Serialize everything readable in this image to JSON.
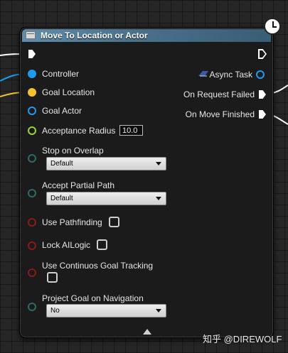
{
  "node": {
    "title": "Move To Location or Actor",
    "inputs": [
      {
        "label": "Controller",
        "color": "#1e9bf0",
        "filled": true
      },
      {
        "label": "Goal Location",
        "color": "#f6c22a",
        "filled": true
      },
      {
        "label": "Goal Actor",
        "color": "#1e9bf0",
        "filled": false
      },
      {
        "label": "Acceptance Radius",
        "color": "#9bd33a",
        "filled": false,
        "value": "10.0"
      },
      {
        "label": "Stop on Overlap",
        "color": "#2a6b6b",
        "filled": false,
        "dropdown": "Default"
      },
      {
        "label": "Accept Partial Path",
        "color": "#2a6b6b",
        "filled": false,
        "dropdown": "Default"
      },
      {
        "label": "Use Pathfinding",
        "color": "#8b1a1a",
        "filled": false,
        "checked": false
      },
      {
        "label": "Lock AILogic",
        "color": "#8b1a1a",
        "filled": false,
        "checked": false
      },
      {
        "label": "Use Continuos Goal Tracking",
        "color": "#8b1a1a",
        "filled": false,
        "checked": false
      },
      {
        "label": "Project Goal on Navigation",
        "color": "#2a6b6b",
        "filled": false,
        "dropdown": "No"
      }
    ],
    "outputs": [
      {
        "label": "Async Task",
        "color": "#1e9bf0"
      },
      {
        "label": "On Request Failed"
      },
      {
        "label": "On Move Finished"
      }
    ]
  },
  "watermark": "知乎 @DIREWOLF"
}
